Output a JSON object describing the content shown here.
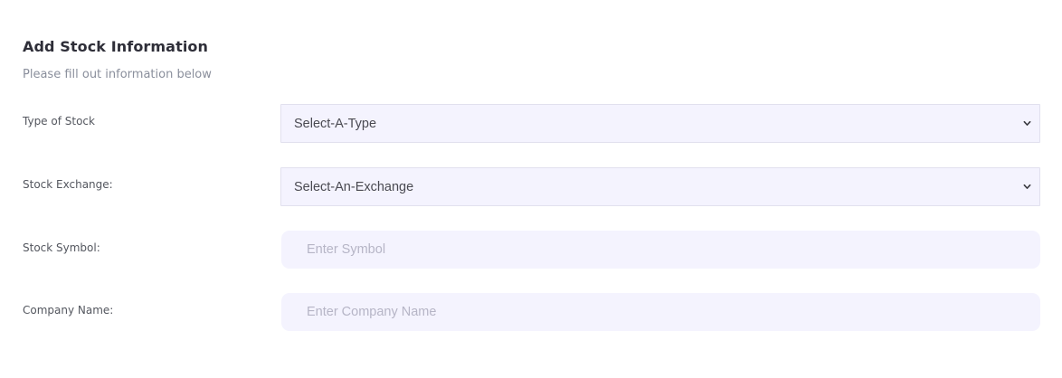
{
  "form": {
    "title": "Add Stock Information",
    "subtitle": "Please fill out information below",
    "fields": {
      "stock_type": {
        "label": "Type of Stock",
        "selected": "Select-A-Type"
      },
      "stock_exchange": {
        "label": "Stock Exchange:",
        "selected": "Select-An-Exchange"
      },
      "stock_symbol": {
        "label": "Stock Symbol:",
        "value": "",
        "placeholder": "Enter Symbol"
      },
      "company_name": {
        "label": "Company Name:",
        "value": "",
        "placeholder": "Enter Company Name"
      }
    }
  },
  "icons": {
    "dropdown": "chevron-down-icon"
  },
  "colors": {
    "field_background": "#f4f3fe",
    "title": "#2e2e38",
    "label": "#54575f",
    "subtitle": "#8a8f9c",
    "placeholder": "#b6b5c6"
  }
}
